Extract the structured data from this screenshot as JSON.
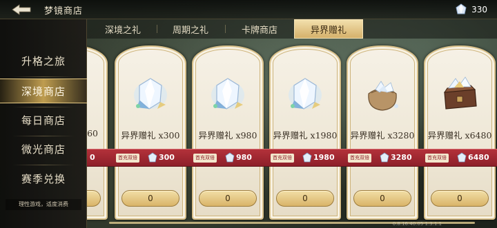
{
  "header": {
    "title": "梦镜商店",
    "currency_amount": "330"
  },
  "sidebar": {
    "items": [
      {
        "label": "升格之旅",
        "active": false
      },
      {
        "label": "深境商店",
        "active": true
      },
      {
        "label": "每日商店",
        "active": false
      },
      {
        "label": "微光商店",
        "active": false
      },
      {
        "label": "赛季兑换",
        "active": false
      }
    ],
    "notice": "理性游戏，适度消费"
  },
  "tabs": [
    {
      "label": "深境之礼",
      "active": false
    },
    {
      "label": "周期之礼",
      "active": false
    },
    {
      "label": "卡牌商店",
      "active": false
    },
    {
      "label": "异界赠礼",
      "active": true
    }
  ],
  "cards": [
    {
      "name": "60",
      "price": "0",
      "buy_label": "0",
      "icon": "gem-cluster-icon"
    },
    {
      "name": "异界赠礼 x300",
      "badge": "首充双倍",
      "price": "300",
      "buy_label": "0",
      "icon": "gem-cluster-icon"
    },
    {
      "name": "异界赠礼 x980",
      "badge": "首充双倍",
      "price": "980",
      "buy_label": "0",
      "icon": "gem-cluster-icon"
    },
    {
      "name": "异界赠礼 x1980",
      "badge": "首充双倍",
      "price": "1980",
      "buy_label": "0",
      "icon": "gem-cluster-icon"
    },
    {
      "name": "异界赠礼 x3280",
      "badge": "首充双倍",
      "price": "3280",
      "buy_label": "0",
      "icon": "gem-sack-icon"
    },
    {
      "name": "异界赠礼 x6480",
      "badge": "首充双倍",
      "price": "6480",
      "buy_label": "0",
      "icon": "gem-chest-icon"
    }
  ],
  "footer": {
    "version": "0.8.16.40.05 1.3.1.1"
  },
  "colors": {
    "accent_gold": "#d9b469",
    "ribbon_red": "#a12a33"
  }
}
